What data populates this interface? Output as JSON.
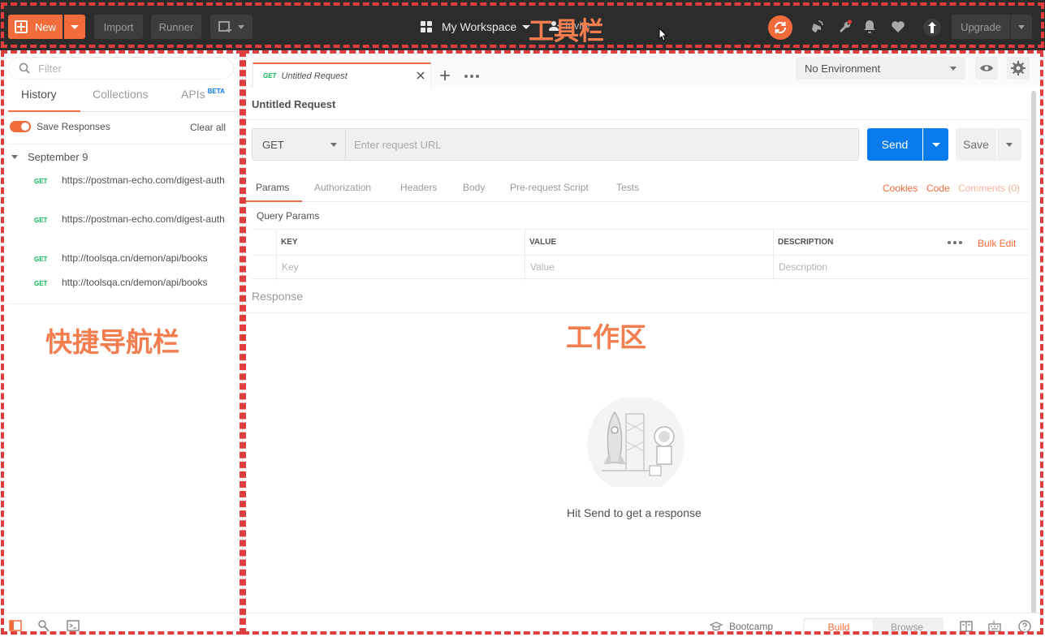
{
  "toolbar": {
    "new_label": "New",
    "import_label": "Import",
    "runner_label": "Runner",
    "workspace_label": "My Workspace",
    "invite_label": "Invite",
    "upgrade_label": "Upgrade",
    "annotation_label": "工具栏"
  },
  "sidebar": {
    "filter_placeholder": "Filter",
    "tabs": [
      {
        "label": "History",
        "active": true
      },
      {
        "label": "Collections",
        "active": false
      },
      {
        "label": "APIs",
        "badge": "BETA",
        "active": false
      }
    ],
    "save_responses_label": "Save Responses",
    "clear_all_label": "Clear all",
    "group_date": "September 9",
    "history": [
      {
        "method": "GET",
        "url": "https://postman-echo.com/digest-auth"
      },
      {
        "method": "GET",
        "url": "https://postman-echo.com/digest-auth"
      },
      {
        "method": "GET",
        "url": "http://toolsqa.cn/demon/api/books"
      },
      {
        "method": "GET",
        "url": "http://toolsqa.cn/demon/api/books"
      }
    ],
    "annotation_label": "快捷导航栏"
  },
  "workspace": {
    "tab": {
      "method": "GET",
      "name": "Untitled Request"
    },
    "environment": "No Environment",
    "request_title": "Untitled Request",
    "method": "GET",
    "url_placeholder": "Enter request URL",
    "send_label": "Send",
    "save_label": "Save",
    "request_tabs": [
      "Params",
      "Authorization",
      "Headers",
      "Body",
      "Pre-request Script",
      "Tests"
    ],
    "links": {
      "cookies": "Cookies",
      "code": "Code",
      "comments": "Comments (0)"
    },
    "query_params_title": "Query Params",
    "table": {
      "headers": [
        "KEY",
        "VALUE",
        "DESCRIPTION"
      ],
      "placeholders": [
        "Key",
        "Value",
        "Description"
      ],
      "bulk_edit": "Bulk Edit"
    },
    "response_title": "Response",
    "hit_send_text": "Hit Send to get a response",
    "annotation_label": "工作区"
  },
  "status_bar": {
    "bootcamp_label": "Bootcamp",
    "build_label": "Build",
    "browse_label": "Browse"
  },
  "colors": {
    "accent": "#f26b3a",
    "send_blue": "#097bed",
    "get_green": "#0cbb52",
    "annotation_red": "#e03e3e",
    "annotation_text": "#f47d4f"
  }
}
